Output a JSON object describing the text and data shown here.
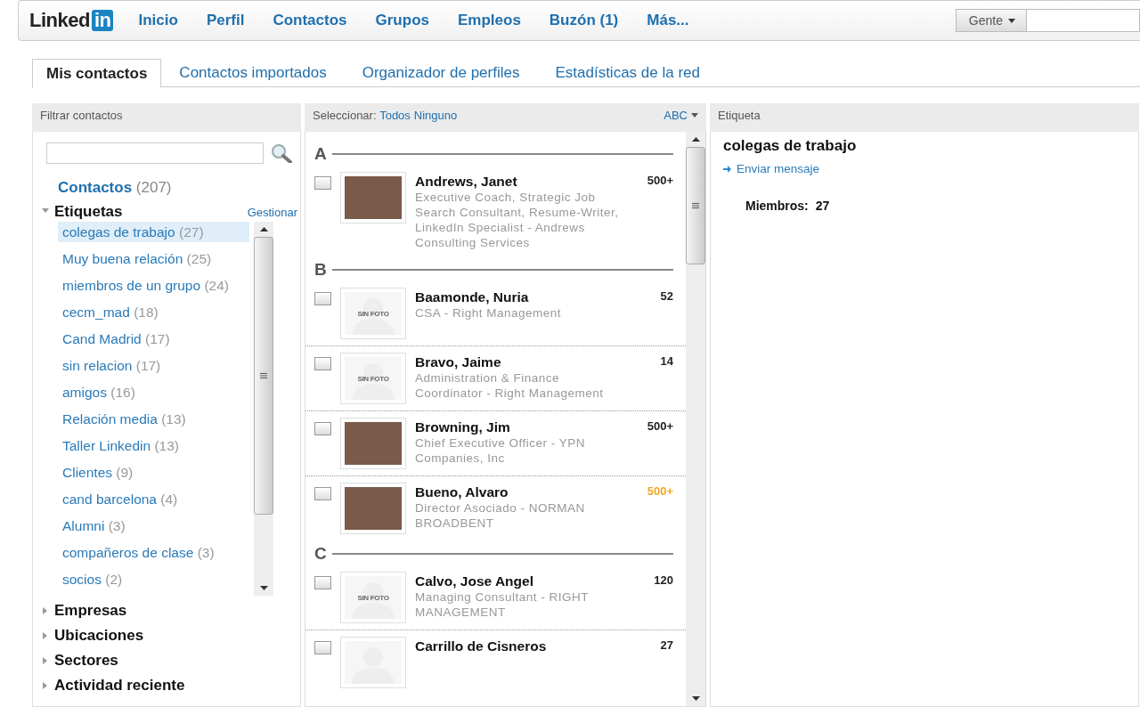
{
  "header": {
    "logo": {
      "text": "Linked",
      "badge": "in"
    },
    "nav": [
      {
        "label": "Inicio"
      },
      {
        "label": "Perfil"
      },
      {
        "label": "Contactos"
      },
      {
        "label": "Grupos"
      },
      {
        "label": "Empleos"
      },
      {
        "label": "Buzón (1)"
      },
      {
        "label": "Más..."
      }
    ],
    "search": {
      "scope": "Gente"
    }
  },
  "tabs": [
    {
      "label": "Mis contactos",
      "selected": true
    },
    {
      "label": "Contactos importados",
      "selected": false
    },
    {
      "label": "Organizador de perfiles",
      "selected": false
    },
    {
      "label": "Estadísticas de la red",
      "selected": false
    }
  ],
  "filter_panel": {
    "title": "Filtrar contactos",
    "all": {
      "label": "Contactos",
      "count": "(207)"
    },
    "sections": [
      {
        "label": "Etiquetas",
        "expanded": true,
        "action": "Gestionar",
        "items": [
          {
            "name": "colegas de trabajo",
            "count": "(27)",
            "selected": true
          },
          {
            "name": "Muy buena relación",
            "count": "(25)",
            "selected": false
          },
          {
            "name": "miembros de un grupo",
            "count": "(24)",
            "selected": false
          },
          {
            "name": "cecm_mad",
            "count": "(18)",
            "selected": false
          },
          {
            "name": "Cand Madrid",
            "count": "(17)",
            "selected": false
          },
          {
            "name": "sin relacion",
            "count": "(17)",
            "selected": false
          },
          {
            "name": "amigos",
            "count": "(16)",
            "selected": false
          },
          {
            "name": "Relación media",
            "count": "(13)",
            "selected": false
          },
          {
            "name": "Taller Linkedin",
            "count": "(13)",
            "selected": false
          },
          {
            "name": "Clientes",
            "count": "(9)",
            "selected": false
          },
          {
            "name": "cand barcelona",
            "count": "(4)",
            "selected": false
          },
          {
            "name": "Alumni",
            "count": "(3)",
            "selected": false
          },
          {
            "name": "compañeros de clase",
            "count": "(3)",
            "selected": false
          },
          {
            "name": "socios",
            "count": "(2)",
            "selected": false
          }
        ]
      },
      {
        "label": "Empresas",
        "expanded": false
      },
      {
        "label": "Ubicaciones",
        "expanded": false
      },
      {
        "label": "Sectores",
        "expanded": false
      },
      {
        "label": "Actividad reciente",
        "expanded": false
      }
    ]
  },
  "contacts_panel": {
    "select_label": "Seleccionar:",
    "select_all": "Todos",
    "select_none": "Ninguno",
    "sort": "ABC",
    "groups": [
      {
        "letter": "A",
        "contacts": [
          {
            "name": "Andrews, Janet",
            "headline": "Executive Coach, Strategic Job Search Consultant, Resume-Writer, LinkedIn Specialist - Andrews Consulting Services",
            "count": "500+",
            "color": "#222222",
            "checked": false,
            "photo": {
              "kind": "photo"
            }
          }
        ]
      },
      {
        "letter": "B",
        "contacts": [
          {
            "name": "Baamonde, Nuria",
            "headline": "CSA - Right Management",
            "count": "52",
            "color": "#222222",
            "checked": false,
            "photo": {
              "kind": "none",
              "label": "SIN FOTO"
            }
          },
          {
            "name": "Bravo, Jaime",
            "headline": "Administration & Finance Coordinator - Right Management",
            "count": "14",
            "color": "#222222",
            "checked": false,
            "photo": {
              "kind": "none",
              "label": "SIN FOTO"
            }
          },
          {
            "name": "Browning, Jim",
            "headline": "Chief Executive Officer - YPN Companies, Inc",
            "count": "500+",
            "color": "#222222",
            "checked": false,
            "photo": {
              "kind": "photo"
            }
          },
          {
            "name": "Bueno, Alvaro",
            "headline": "Director Asociado - NORMAN BROADBENT",
            "count": "500+",
            "color": "#f5a623",
            "checked": false,
            "photo": {
              "kind": "photo"
            }
          }
        ]
      },
      {
        "letter": "C",
        "contacts": [
          {
            "name": "Calvo, Jose Angel",
            "headline": "Managing Consultant - RIGHT MANAGEMENT",
            "count": "120",
            "color": "#222222",
            "checked": false,
            "photo": {
              "kind": "none",
              "label": "SIN FOTO"
            }
          },
          {
            "name": "Carrillo de Cisneros",
            "count": "27",
            "color": "#222222",
            "checked": false,
            "photo": {
              "kind": "none"
            }
          }
        ]
      }
    ]
  },
  "detail_panel": {
    "title": "Etiqueta",
    "tag_name": "colegas de trabajo",
    "action": "Enviar mensaje",
    "members_label": "Miembros:",
    "members_count": "27"
  }
}
